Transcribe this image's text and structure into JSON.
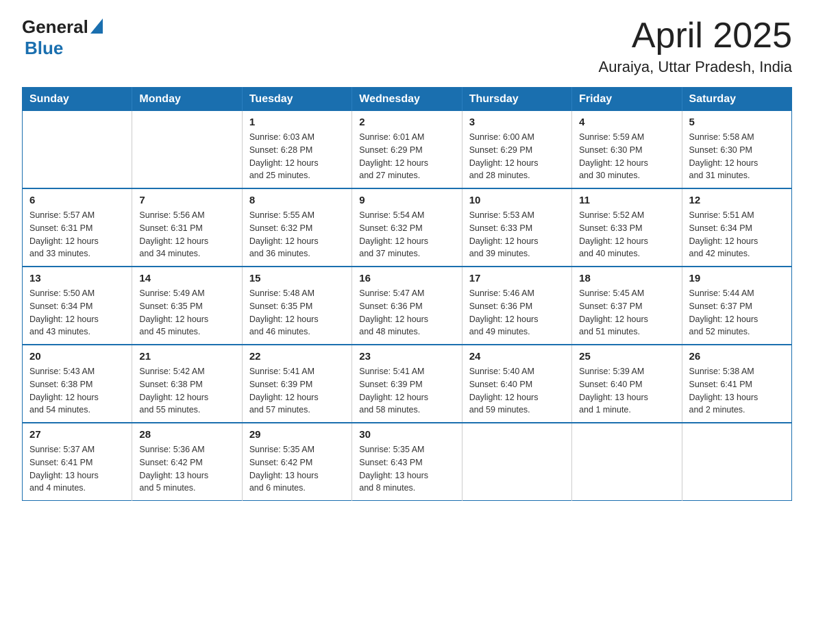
{
  "header": {
    "logo_general": "General",
    "logo_blue": "Blue",
    "month_title": "April 2025",
    "location": "Auraiya, Uttar Pradesh, India"
  },
  "days_of_week": [
    "Sunday",
    "Monday",
    "Tuesday",
    "Wednesday",
    "Thursday",
    "Friday",
    "Saturday"
  ],
  "weeks": [
    [
      {
        "day": "",
        "info": ""
      },
      {
        "day": "",
        "info": ""
      },
      {
        "day": "1",
        "info": "Sunrise: 6:03 AM\nSunset: 6:28 PM\nDaylight: 12 hours\nand 25 minutes."
      },
      {
        "day": "2",
        "info": "Sunrise: 6:01 AM\nSunset: 6:29 PM\nDaylight: 12 hours\nand 27 minutes."
      },
      {
        "day": "3",
        "info": "Sunrise: 6:00 AM\nSunset: 6:29 PM\nDaylight: 12 hours\nand 28 minutes."
      },
      {
        "day": "4",
        "info": "Sunrise: 5:59 AM\nSunset: 6:30 PM\nDaylight: 12 hours\nand 30 minutes."
      },
      {
        "day": "5",
        "info": "Sunrise: 5:58 AM\nSunset: 6:30 PM\nDaylight: 12 hours\nand 31 minutes."
      }
    ],
    [
      {
        "day": "6",
        "info": "Sunrise: 5:57 AM\nSunset: 6:31 PM\nDaylight: 12 hours\nand 33 minutes."
      },
      {
        "day": "7",
        "info": "Sunrise: 5:56 AM\nSunset: 6:31 PM\nDaylight: 12 hours\nand 34 minutes."
      },
      {
        "day": "8",
        "info": "Sunrise: 5:55 AM\nSunset: 6:32 PM\nDaylight: 12 hours\nand 36 minutes."
      },
      {
        "day": "9",
        "info": "Sunrise: 5:54 AM\nSunset: 6:32 PM\nDaylight: 12 hours\nand 37 minutes."
      },
      {
        "day": "10",
        "info": "Sunrise: 5:53 AM\nSunset: 6:33 PM\nDaylight: 12 hours\nand 39 minutes."
      },
      {
        "day": "11",
        "info": "Sunrise: 5:52 AM\nSunset: 6:33 PM\nDaylight: 12 hours\nand 40 minutes."
      },
      {
        "day": "12",
        "info": "Sunrise: 5:51 AM\nSunset: 6:34 PM\nDaylight: 12 hours\nand 42 minutes."
      }
    ],
    [
      {
        "day": "13",
        "info": "Sunrise: 5:50 AM\nSunset: 6:34 PM\nDaylight: 12 hours\nand 43 minutes."
      },
      {
        "day": "14",
        "info": "Sunrise: 5:49 AM\nSunset: 6:35 PM\nDaylight: 12 hours\nand 45 minutes."
      },
      {
        "day": "15",
        "info": "Sunrise: 5:48 AM\nSunset: 6:35 PM\nDaylight: 12 hours\nand 46 minutes."
      },
      {
        "day": "16",
        "info": "Sunrise: 5:47 AM\nSunset: 6:36 PM\nDaylight: 12 hours\nand 48 minutes."
      },
      {
        "day": "17",
        "info": "Sunrise: 5:46 AM\nSunset: 6:36 PM\nDaylight: 12 hours\nand 49 minutes."
      },
      {
        "day": "18",
        "info": "Sunrise: 5:45 AM\nSunset: 6:37 PM\nDaylight: 12 hours\nand 51 minutes."
      },
      {
        "day": "19",
        "info": "Sunrise: 5:44 AM\nSunset: 6:37 PM\nDaylight: 12 hours\nand 52 minutes."
      }
    ],
    [
      {
        "day": "20",
        "info": "Sunrise: 5:43 AM\nSunset: 6:38 PM\nDaylight: 12 hours\nand 54 minutes."
      },
      {
        "day": "21",
        "info": "Sunrise: 5:42 AM\nSunset: 6:38 PM\nDaylight: 12 hours\nand 55 minutes."
      },
      {
        "day": "22",
        "info": "Sunrise: 5:41 AM\nSunset: 6:39 PM\nDaylight: 12 hours\nand 57 minutes."
      },
      {
        "day": "23",
        "info": "Sunrise: 5:41 AM\nSunset: 6:39 PM\nDaylight: 12 hours\nand 58 minutes."
      },
      {
        "day": "24",
        "info": "Sunrise: 5:40 AM\nSunset: 6:40 PM\nDaylight: 12 hours\nand 59 minutes."
      },
      {
        "day": "25",
        "info": "Sunrise: 5:39 AM\nSunset: 6:40 PM\nDaylight: 13 hours\nand 1 minute."
      },
      {
        "day": "26",
        "info": "Sunrise: 5:38 AM\nSunset: 6:41 PM\nDaylight: 13 hours\nand 2 minutes."
      }
    ],
    [
      {
        "day": "27",
        "info": "Sunrise: 5:37 AM\nSunset: 6:41 PM\nDaylight: 13 hours\nand 4 minutes."
      },
      {
        "day": "28",
        "info": "Sunrise: 5:36 AM\nSunset: 6:42 PM\nDaylight: 13 hours\nand 5 minutes."
      },
      {
        "day": "29",
        "info": "Sunrise: 5:35 AM\nSunset: 6:42 PM\nDaylight: 13 hours\nand 6 minutes."
      },
      {
        "day": "30",
        "info": "Sunrise: 5:35 AM\nSunset: 6:43 PM\nDaylight: 13 hours\nand 8 minutes."
      },
      {
        "day": "",
        "info": ""
      },
      {
        "day": "",
        "info": ""
      },
      {
        "day": "",
        "info": ""
      }
    ]
  ]
}
